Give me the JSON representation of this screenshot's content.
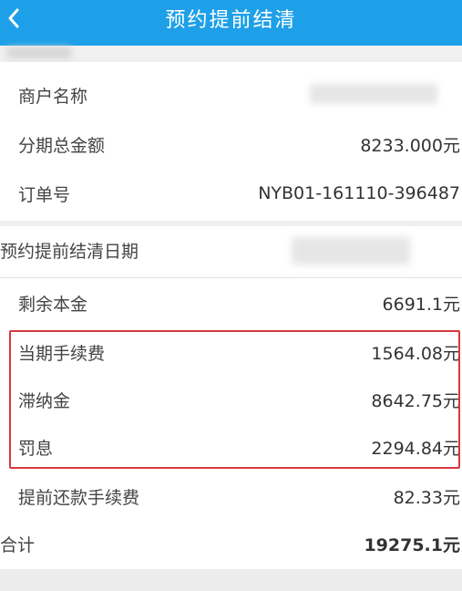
{
  "header": {
    "title": "预约提前结清"
  },
  "merchant": {
    "label": "商户名称",
    "value": ""
  },
  "installment_total": {
    "label": "分期总金额",
    "value": "8233.000元"
  },
  "order_no": {
    "label": "订单号",
    "value": "NYB01-161110-396487"
  },
  "settle_date": {
    "label": "预约提前结清日期"
  },
  "remaining_principal": {
    "label": "剩余本金",
    "value": "6691.1元"
  },
  "current_fee": {
    "label": "当期手续费",
    "value": "1564.08元"
  },
  "late_fee": {
    "label": "滞纳金",
    "value": "8642.75元"
  },
  "penalty": {
    "label": "罚息",
    "value": "2294.84元"
  },
  "prepay_fee": {
    "label": "提前还款手续费",
    "value": "82.33元"
  },
  "total": {
    "label": "合计",
    "value": "19275.1元"
  },
  "colors": {
    "header_bg": "#1ea0e8",
    "highlight_border": "#d8393d"
  }
}
